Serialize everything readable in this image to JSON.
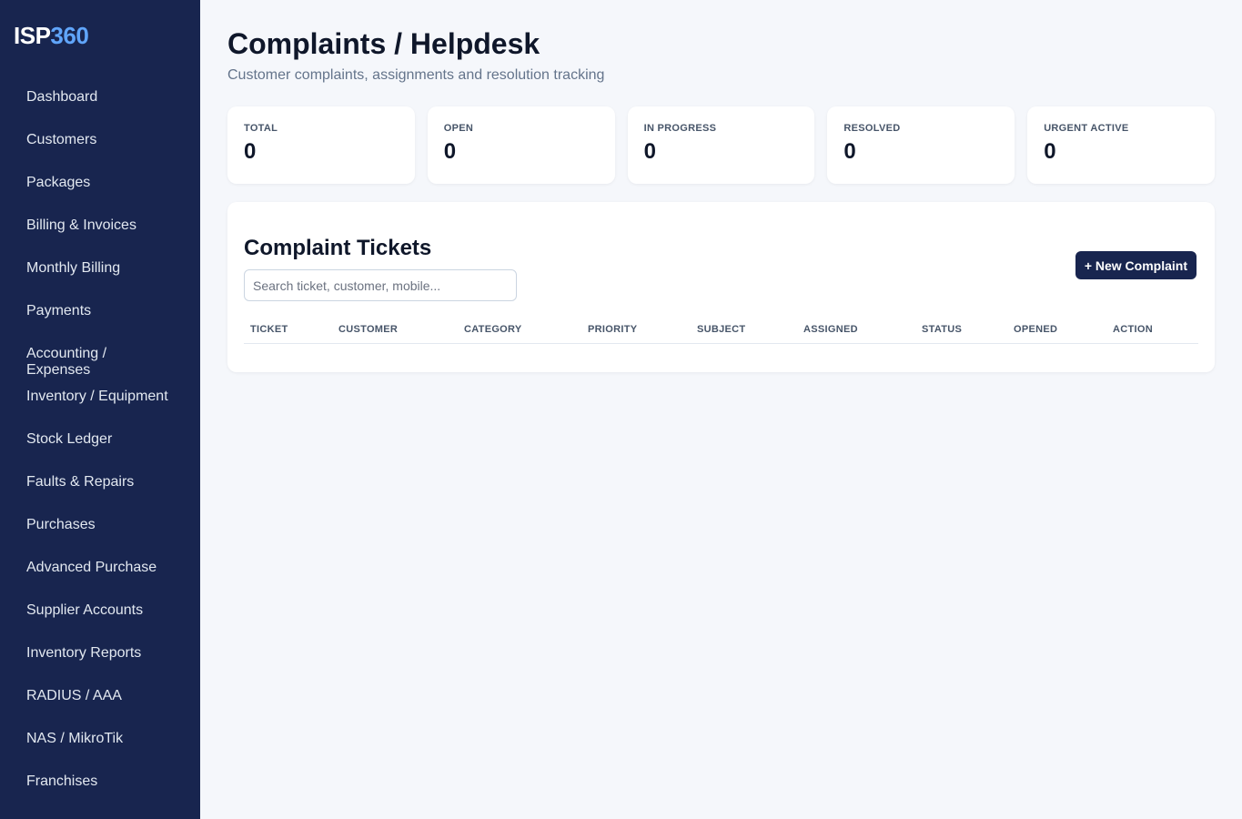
{
  "app": {
    "logo_part1": "ISP",
    "logo_part2": "360"
  },
  "sidebar": {
    "items": [
      {
        "label": "Dashboard"
      },
      {
        "label": "Customers"
      },
      {
        "label": "Packages"
      },
      {
        "label": "Billing & Invoices"
      },
      {
        "label": "Monthly Billing"
      },
      {
        "label": "Payments"
      },
      {
        "label": "Accounting / Expenses"
      },
      {
        "label": "Inventory / Equipment"
      },
      {
        "label": "Stock Ledger"
      },
      {
        "label": "Faults & Repairs"
      },
      {
        "label": "Purchases"
      },
      {
        "label": "Advanced Purchase"
      },
      {
        "label": "Supplier Accounts"
      },
      {
        "label": "Inventory Reports"
      },
      {
        "label": "RADIUS / AAA"
      },
      {
        "label": "NAS / MikroTik"
      },
      {
        "label": "Franchises"
      }
    ]
  },
  "page": {
    "title": "Complaints / Helpdesk",
    "subtitle": "Customer complaints, assignments and resolution tracking"
  },
  "stats": [
    {
      "label": "TOTAL",
      "value": "0"
    },
    {
      "label": "OPEN",
      "value": "0"
    },
    {
      "label": "IN PROGRESS",
      "value": "0"
    },
    {
      "label": "RESOLVED",
      "value": "0"
    },
    {
      "label": "URGENT ACTIVE",
      "value": "0"
    }
  ],
  "tickets_panel": {
    "title": "Complaint Tickets",
    "new_button_label": "+ New Complaint",
    "search_placeholder": "Search ticket, customer, mobile...",
    "columns": [
      "TICKET",
      "CUSTOMER",
      "CATEGORY",
      "PRIORITY",
      "SUBJECT",
      "ASSIGNED",
      "STATUS",
      "OPENED",
      "ACTION"
    ]
  },
  "colors": {
    "sidebar_bg": "#18254f",
    "accent": "#60a5fa",
    "page_bg": "#f5f7fb",
    "primary_button": "#18254f"
  }
}
